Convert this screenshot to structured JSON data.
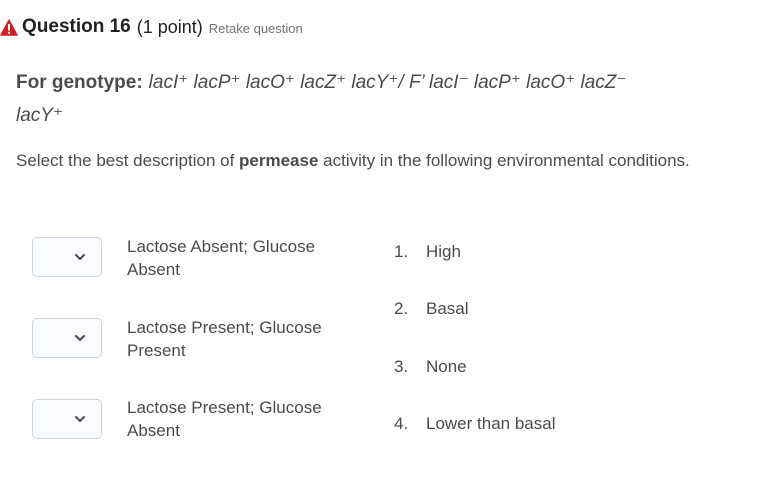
{
  "question": {
    "icon": "warning-icon",
    "title": "Question 16",
    "points": "(1 point)",
    "retake_label": "Retake question"
  },
  "genotype": {
    "lead": "For genotype:",
    "line1": "lacI⁺ lacP⁺ lacO⁺ lacZ⁺ lacY⁺/ F’ lacI⁻ lacP⁺ lacO⁺ lacZ⁻",
    "line2": "lacY⁺"
  },
  "instruction": {
    "before": "Select the best description of ",
    "bold": "permease",
    "after": " activity in the following environmental conditions."
  },
  "conditions": [
    {
      "text": "Lactose Absent; Glucose Absent",
      "selected": ""
    },
    {
      "text": "Lactose Present; Glucose Present",
      "selected": ""
    },
    {
      "text": "Lactose Present; Glucose Absent",
      "selected": ""
    }
  ],
  "options": [
    {
      "number": "1.",
      "label": "High"
    },
    {
      "number": "2.",
      "label": "Basal"
    },
    {
      "number": "3.",
      "label": "None"
    },
    {
      "number": "4.",
      "label": "Lower than basal"
    }
  ],
  "colors": {
    "warning": "#cd2026",
    "text": "#494c4e",
    "title": "#202122",
    "muted": "#6e7376",
    "select_border": "#cdd5dc"
  }
}
